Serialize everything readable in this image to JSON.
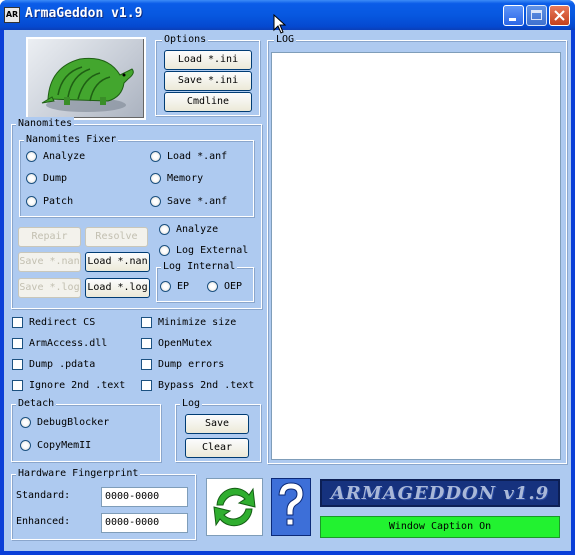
{
  "window": {
    "title": "ArmaGeddon v1.9",
    "icon_text": "AR"
  },
  "options": {
    "title": "Options",
    "buttons": [
      "Load *.ini",
      "Save *.ini",
      "Cmdline"
    ]
  },
  "log_panel": {
    "title": "LOG"
  },
  "nanomites": {
    "title": "Nanomites",
    "fixer_title": "Nanomites Fixer",
    "fixer_options": [
      "Analyze",
      "Load *.anf",
      "Dump",
      "Memory",
      "Patch",
      "Save *.anf"
    ],
    "buttons": {
      "repair": "Repair",
      "resolve": "Resolve",
      "save_nan": "Save *.nan",
      "load_nan": "Load *.nan",
      "save_log": "Save *.log",
      "load_log": "Load *.log"
    },
    "analyze_label": "Analyze",
    "log_external_label": "Log External",
    "log_internal_title": "Log Internal",
    "ep_label": "EP",
    "oep_label": "OEP"
  },
  "checkboxes": [
    "Redirect CS",
    "Minimize size",
    "ArmAccess.dll",
    "OpenMutex",
    "Dump .pdata",
    "Dump errors",
    "Ignore 2nd .text",
    "Bypass 2nd .text"
  ],
  "detach": {
    "title": "Detach",
    "options": [
      "DebugBlocker",
      "CopyMemII"
    ]
  },
  "log_group": {
    "title": "Log",
    "save": "Save",
    "clear": "Clear"
  },
  "hardware": {
    "title": "Hardware Fingerprint",
    "standard_label": "Standard:",
    "standard_value": "0000-0000",
    "enhanced_label": "Enhanced:",
    "enhanced_value": "0000-0000"
  },
  "banner": {
    "text": "ARMAGEDDON v1.9"
  },
  "status": {
    "text": "Window Caption On",
    "color": "#22f230"
  },
  "icons": [
    "app-icon",
    "armadillo-logo",
    "refresh-icon",
    "help-icon"
  ]
}
